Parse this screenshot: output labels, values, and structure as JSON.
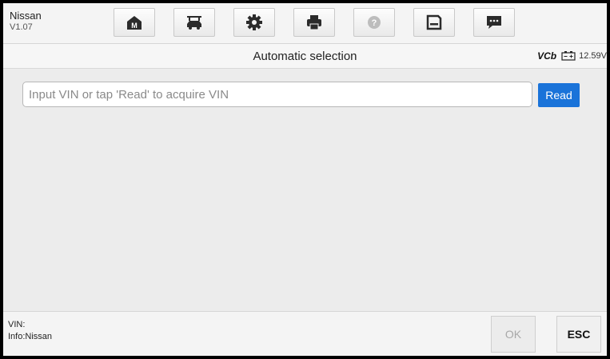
{
  "header": {
    "vehicle_make": "Nissan",
    "software_version": "V1.07",
    "toolbar_icons": [
      "home-icon",
      "vehicle-lift-icon",
      "settings-gear-icon",
      "printer-icon",
      "help-icon",
      "save-icon",
      "data-logging-icon"
    ]
  },
  "titlebar": {
    "title": "Automatic selection",
    "vcb_label": "VCb",
    "battery_voltage": "12.59V"
  },
  "vin_entry": {
    "placeholder": "Input VIN or tap 'Read' to acquire VIN",
    "value": "",
    "read_label": "Read"
  },
  "footer": {
    "vin_line": "VIN:",
    "info_line": "Info:Nissan",
    "ok_label": "OK",
    "esc_label": "ESC"
  },
  "colors": {
    "accent_blue": "#1a73d9",
    "vcb_green": "#2a8a2a"
  }
}
